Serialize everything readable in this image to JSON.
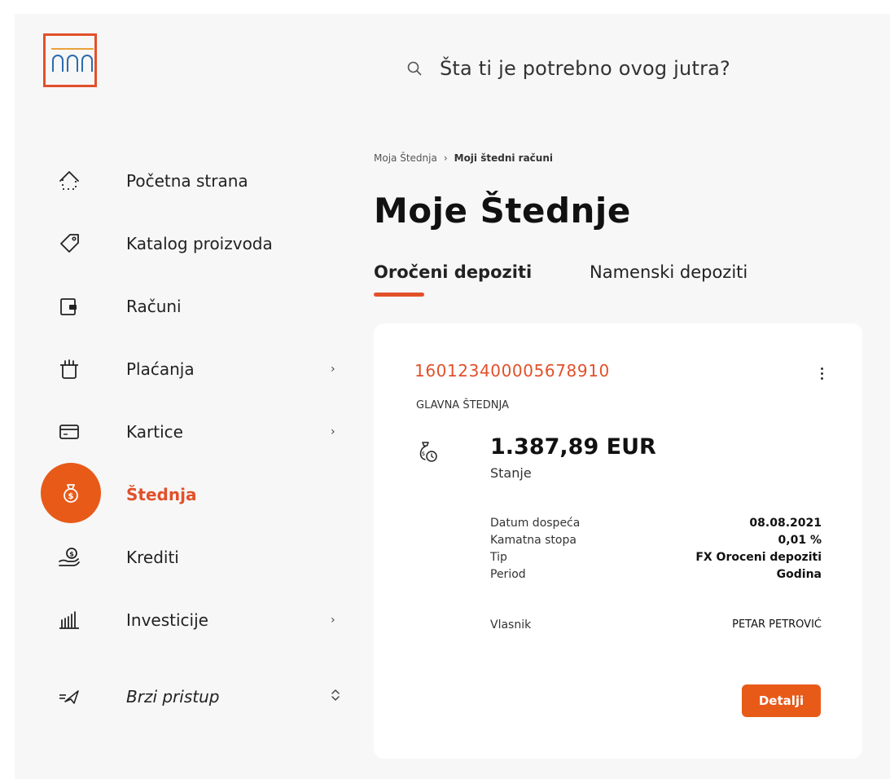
{
  "colors": {
    "accent": "#e2502a",
    "active_bg": "#e85a18",
    "background": "#f7f7f7",
    "card": "#ffffff"
  },
  "search": {
    "placeholder": "Šta ti je potrebno ovog jutra?"
  },
  "sidebar": {
    "items": [
      {
        "label": "Početna strana",
        "icon": "home-icon"
      },
      {
        "label": "Katalog proizvoda",
        "icon": "tag-icon"
      },
      {
        "label": "Računi",
        "icon": "wallet-icon"
      },
      {
        "label": "Plaćanja",
        "icon": "gift-icon",
        "chevron": "›"
      },
      {
        "label": "Kartice",
        "icon": "card-icon",
        "chevron": "›"
      },
      {
        "label": "Štednja",
        "icon": "money-bag-icon",
        "active": true
      },
      {
        "label": "Krediti",
        "icon": "hand-coin-icon"
      },
      {
        "label": "Investicije",
        "icon": "columns-icon",
        "chevron": "›"
      },
      {
        "label": "Brzi pristup",
        "icon": "send-icon",
        "chevron": "⌃⌄"
      }
    ]
  },
  "breadcrumb": {
    "parent": "Moja Štednja",
    "separator": "›",
    "current": "Moji štedni računi"
  },
  "page": {
    "title": "Moje Štednje"
  },
  "tabs": [
    {
      "label": "Oročeni depoziti",
      "active": true
    },
    {
      "label": "Namenski depoziti",
      "active": false
    }
  ],
  "card": {
    "account_number": "160123400005678910",
    "account_type": "GLAVNA ŠTEDNJA",
    "balance": "1.387,89 EUR",
    "balance_label": "Stanje",
    "details": [
      {
        "label": "Datum dospeća",
        "value": "08.08.2021"
      },
      {
        "label": "Kamatna stopa",
        "value": "0,01 %"
      },
      {
        "label": "Tip",
        "value": "FX Oroceni depoziti"
      },
      {
        "label": "Period",
        "value": "Godina"
      }
    ],
    "owner_label": "Vlasnik",
    "owner_value": "PETAR PETROVIĆ",
    "button_label": "Detalji"
  }
}
